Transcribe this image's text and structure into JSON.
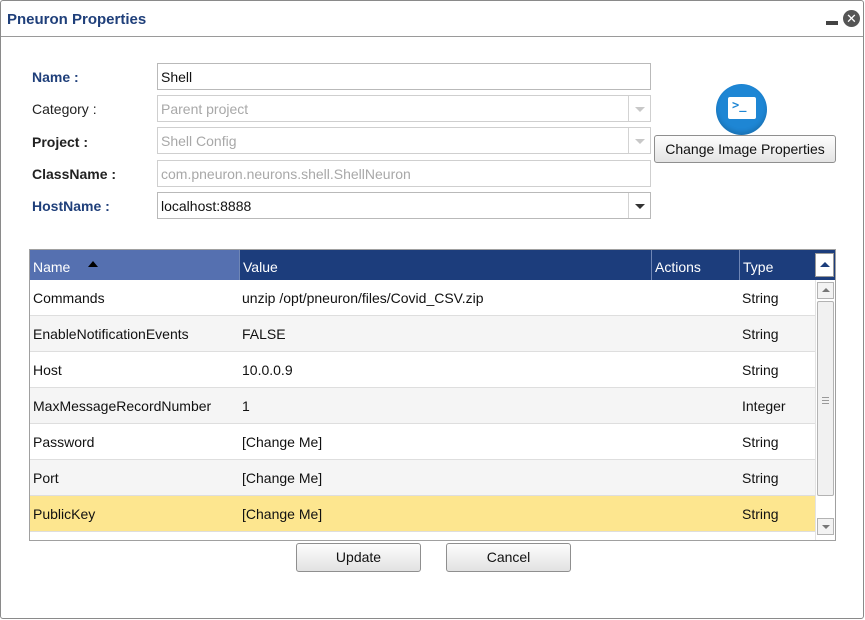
{
  "window": {
    "title": "Pneuron Properties",
    "minimize_icon": "minimize-icon",
    "close_icon": "close-icon",
    "close_glyph": "✕"
  },
  "form": {
    "name": {
      "label": "Name :",
      "value": "Shell"
    },
    "category": {
      "label": "Category :",
      "value": "Parent project"
    },
    "project": {
      "label": "Project :",
      "value": "Shell Config"
    },
    "classname": {
      "label": "ClassName :",
      "value": "com.pneuron.neurons.shell.ShellNeuron"
    },
    "hostname": {
      "label": "HostName :",
      "value": "localhost:8888"
    }
  },
  "image": {
    "icon": "terminal-icon",
    "icon_glyph": ">_",
    "button_label": "Change Image Properties",
    "icon_color": "#1e86d4"
  },
  "grid": {
    "columns": [
      "Name",
      "Value",
      "Actions",
      "Type"
    ],
    "sort_column": "Name",
    "sort_direction": "ascending",
    "rows": [
      {
        "name": "Commands",
        "value": "unzip /opt/pneuron/files/Covid_CSV.zip",
        "actions": "",
        "type": "String"
      },
      {
        "name": "EnableNotificationEvents",
        "value": "FALSE",
        "actions": "",
        "type": "String"
      },
      {
        "name": "Host",
        "value": "10.0.0.9",
        "actions": "",
        "type": "String"
      },
      {
        "name": "MaxMessageRecordNumber",
        "value": "1",
        "actions": "",
        "type": "Integer"
      },
      {
        "name": "Password",
        "value": "[Change Me]",
        "actions": "",
        "type": "String"
      },
      {
        "name": "Port",
        "value": "[Change Me]",
        "actions": "",
        "type": "String"
      },
      {
        "name": "PublicKey",
        "value": "[Change Me]",
        "actions": "",
        "type": "String"
      }
    ],
    "selected_row": "PublicKey",
    "header_color": "#1c3d7c",
    "selected_color": "#fde68f"
  },
  "buttons": {
    "update": "Update",
    "cancel": "Cancel"
  }
}
